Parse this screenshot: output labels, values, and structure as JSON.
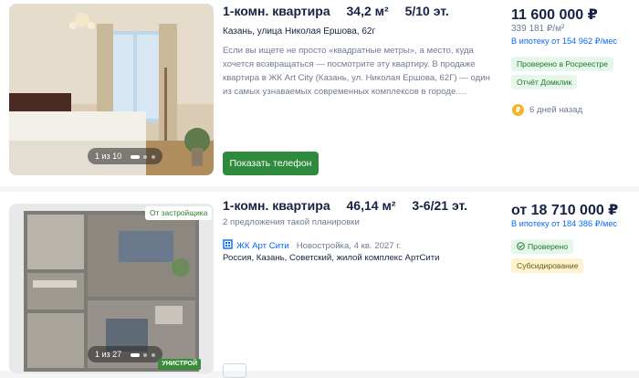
{
  "listings": [
    {
      "title_rooms": "1-комн. квартира",
      "title_area": "34,2 м²",
      "title_floor": "5/10 эт.",
      "address": "Казань, улица Николая Ершова, 62г",
      "description": "Если вы ищете не просто «квадратные метры», а место, куда хочется возвращаться — посмотрите эту квартиру. В продаже квартира в ЖК Art City (Казань, ул. Николая Ершова, 62Г) — один из самых узнаваемых современных комплексов в городе.…",
      "show_phone": "Показать телефон",
      "photo_counter": "1 из 10",
      "price": "11 600 000 ₽",
      "price_per_sqm": "339 181 ₽/м²",
      "mortgage": "В ипотеку от 154 962 ₽/мес",
      "badges": [
        "Проверено в Росреестре",
        "Отчёт Домклик"
      ],
      "age": "6 дней назад"
    },
    {
      "title_rooms": "1-комн. квартира",
      "title_area": "46,14 м²",
      "title_floor": "3-6/21 эт.",
      "subtitle": "2 предложения такой планировки",
      "complex_name": "ЖК Арт Сити",
      "complex_meta": "Новостройка, 4 кв. 2027 г.",
      "location": "Россия, Казань, Советский, жилой комплекс АртСити",
      "developer_badge": "От застройщика",
      "photo_counter": "1 из 27",
      "brand": "УНИСТРОЙ",
      "price": "от 18 710 000 ₽",
      "mortgage": "В ипотеку от 184 386 ₽/мес",
      "badges": [
        "Проверено",
        "Субсидирование"
      ]
    }
  ],
  "colors": {
    "accent_green": "#2e8b3e",
    "link_blue": "#0468ff",
    "text_dark": "#152242",
    "text_muted": "#707a95"
  }
}
